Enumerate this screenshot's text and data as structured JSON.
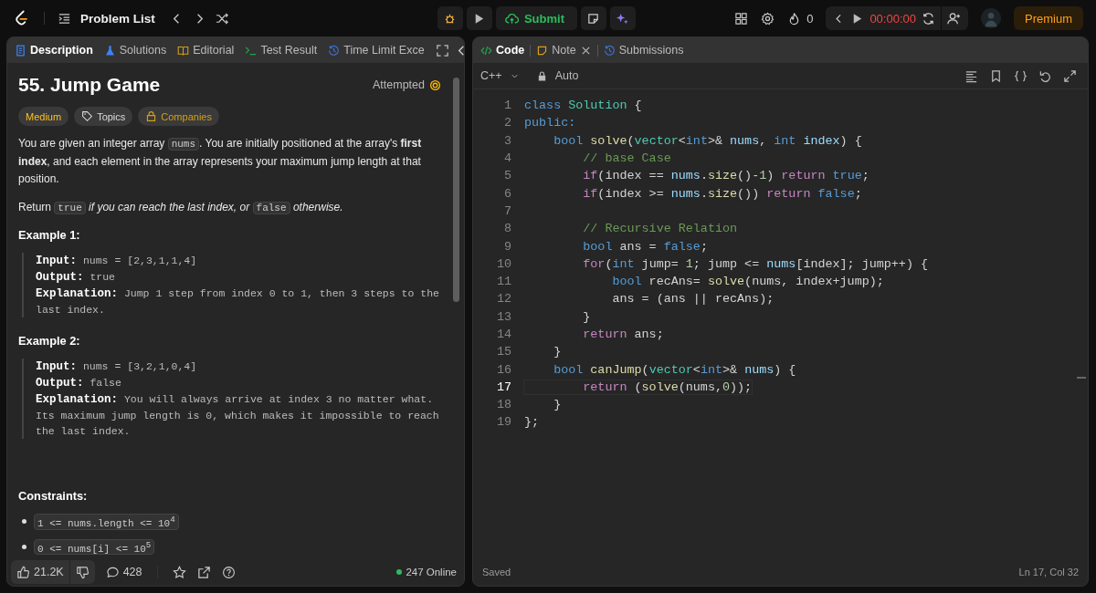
{
  "topbar": {
    "problem_list": "Problem List",
    "submit": "Submit",
    "streak": "0",
    "timer": "00:00:00",
    "premium": "Premium"
  },
  "left_panel": {
    "tabs": [
      {
        "label": "Description",
        "selected": true
      },
      {
        "label": "Solutions",
        "selected": false
      },
      {
        "label": "Editorial",
        "selected": false
      },
      {
        "label": "Test Result",
        "selected": false
      },
      {
        "label": "Time Limit Exce",
        "selected": false
      }
    ],
    "title": "55. Jump Game",
    "status": "Attempted",
    "tags": [
      {
        "label": "Medium",
        "kind": "difficulty"
      },
      {
        "label": "Topics",
        "kind": "topics"
      },
      {
        "label": "Companies",
        "kind": "companies"
      }
    ],
    "paragraphs": [
      [
        {
          "text": "You are given an integer array ",
          "kind": "text"
        },
        {
          "text": "nums",
          "kind": "code"
        },
        {
          "text": ". You are initially positioned at the array's **first index**, and each element in the array represents your maximum jump length at that position.",
          "kind": "text"
        }
      ],
      [
        {
          "text": "Return ",
          "kind": "text"
        },
        {
          "text": "true",
          "kind": "code"
        },
        {
          "text": " if you can reach the last index, or ",
          "kind": "italic"
        },
        {
          "text": "false",
          "kind": "code"
        },
        {
          "text": " otherwise.",
          "kind": "italic"
        }
      ]
    ],
    "examples": [
      {
        "heading": "Example 1:",
        "lines": [
          {
            "label": "Input:",
            "value": "nums = [2,3,1,1,4]"
          },
          {
            "label": "Output:",
            "value": "true"
          },
          {
            "label": "Explanation:",
            "value": "Jump 1 step from index 0 to 1, then 3 steps to the last index."
          }
        ]
      },
      {
        "heading": "Example 2:",
        "lines": [
          {
            "label": "Input:",
            "value": "nums = [3,2,1,0,4]"
          },
          {
            "label": "Output:",
            "value": "false"
          },
          {
            "label": "Explanation:",
            "value": "You will always arrive at index 3 no matter what. Its maximum jump length is 0, which makes it impossible to reach the last index."
          }
        ]
      }
    ],
    "constraints_heading": "Constraints:",
    "constraints": [
      "1 <= nums.length <= 10$^{4}$",
      "0 <= nums[i] <= 10$^{5}$"
    ],
    "footer": {
      "likes": "21.2K",
      "comments": "428",
      "online": "247 Online"
    }
  },
  "right_panel": {
    "tabs": [
      {
        "label": "Code",
        "selected": true,
        "closable": false
      },
      {
        "label": "Note",
        "selected": false,
        "closable": true
      },
      {
        "label": "Submissions",
        "selected": false,
        "closable": false
      }
    ],
    "language": "C++",
    "mode": "Auto",
    "code": [
      {
        "n": "1",
        "current": false,
        "tokens": [
          {
            "text": "class",
            "kind": "keyword"
          },
          {
            "text": " Solution",
            "kind": "type"
          },
          {
            "text": " {",
            "kind": "plain"
          }
        ]
      },
      {
        "n": "2",
        "current": false,
        "tokens": [
          {
            "text": "public:",
            "kind": "keyword"
          }
        ]
      },
      {
        "n": "3",
        "current": false,
        "tokens": [
          {
            "text": "    bool",
            "kind": "keyword"
          },
          {
            "text": " solve",
            "kind": "function"
          },
          {
            "text": "(",
            "kind": "plain"
          },
          {
            "text": "vector",
            "kind": "type"
          },
          {
            "text": "<",
            "kind": "plain"
          },
          {
            "text": "int",
            "kind": "keyword"
          },
          {
            "text": ">& ",
            "kind": "plain"
          },
          {
            "text": "nums",
            "kind": "variable"
          },
          {
            "text": ", ",
            "kind": "plain"
          },
          {
            "text": "int",
            "kind": "keyword"
          },
          {
            "text": " index",
            "kind": "variable"
          },
          {
            "text": ") {",
            "kind": "plain"
          }
        ]
      },
      {
        "n": "4",
        "current": false,
        "tokens": [
          {
            "text": "        // base Case",
            "kind": "comment"
          }
        ]
      },
      {
        "n": "5",
        "current": false,
        "tokens": [
          {
            "text": "        if",
            "kind": "control"
          },
          {
            "text": "(index == ",
            "kind": "plain"
          },
          {
            "text": "nums",
            "kind": "variable"
          },
          {
            "text": ".",
            "kind": "plain"
          },
          {
            "text": "size",
            "kind": "function"
          },
          {
            "text": "()-",
            "kind": "plain"
          },
          {
            "text": "1",
            "kind": "number"
          },
          {
            "text": ") ",
            "kind": "plain"
          },
          {
            "text": "return",
            "kind": "control"
          },
          {
            "text": " true",
            "kind": "keyword"
          },
          {
            "text": ";",
            "kind": "plain"
          }
        ]
      },
      {
        "n": "6",
        "current": false,
        "tokens": [
          {
            "text": "        if",
            "kind": "control"
          },
          {
            "text": "(index >= ",
            "kind": "plain"
          },
          {
            "text": "nums",
            "kind": "variable"
          },
          {
            "text": ".",
            "kind": "plain"
          },
          {
            "text": "size",
            "kind": "function"
          },
          {
            "text": "()) ",
            "kind": "plain"
          },
          {
            "text": "return",
            "kind": "control"
          },
          {
            "text": " false",
            "kind": "keyword"
          },
          {
            "text": ";",
            "kind": "plain"
          }
        ]
      },
      {
        "n": "7",
        "current": false
      },
      {
        "n": "8",
        "current": false,
        "tokens": [
          {
            "text": "        // Recursive Relation",
            "kind": "comment"
          }
        ]
      },
      {
        "n": "9",
        "current": false,
        "tokens": [
          {
            "text": "        bool",
            "kind": "keyword"
          },
          {
            "text": " ans = ",
            "kind": "plain"
          },
          {
            "text": "false",
            "kind": "keyword"
          },
          {
            "text": ";",
            "kind": "plain"
          }
        ]
      },
      {
        "n": "10",
        "current": false,
        "tokens": [
          {
            "text": "        for",
            "kind": "control"
          },
          {
            "text": "(",
            "kind": "plain"
          },
          {
            "text": "int",
            "kind": "keyword"
          },
          {
            "text": " jump= ",
            "kind": "plain"
          },
          {
            "text": "1",
            "kind": "number"
          },
          {
            "text": "; jump <= ",
            "kind": "plain"
          },
          {
            "text": "nums",
            "kind": "variable"
          },
          {
            "text": "[index]; jump++) {",
            "kind": "plain"
          }
        ]
      },
      {
        "n": "11",
        "current": false,
        "tokens": [
          {
            "text": "            bool",
            "kind": "keyword"
          },
          {
            "text": " recAns= ",
            "kind": "plain"
          },
          {
            "text": "solve",
            "kind": "function"
          },
          {
            "text": "(nums, index+jump);",
            "kind": "plain"
          }
        ]
      },
      {
        "n": "12",
        "current": false,
        "tokens": [
          {
            "text": "            ans = (ans || recAns);",
            "kind": "plain"
          }
        ]
      },
      {
        "n": "13",
        "current": false,
        "tokens": [
          {
            "text": "        }",
            "kind": "plain"
          }
        ]
      },
      {
        "n": "14",
        "current": false,
        "tokens": [
          {
            "text": "        return",
            "kind": "control"
          },
          {
            "text": " ans;",
            "kind": "plain"
          }
        ]
      },
      {
        "n": "15",
        "current": false,
        "tokens": [
          {
            "text": "    }",
            "kind": "plain"
          }
        ]
      },
      {
        "n": "16",
        "current": false,
        "tokens": [
          {
            "text": "    bool",
            "kind": "keyword"
          },
          {
            "text": " canJump",
            "kind": "function"
          },
          {
            "text": "(",
            "kind": "plain"
          },
          {
            "text": "vector",
            "kind": "type"
          },
          {
            "text": "<",
            "kind": "plain"
          },
          {
            "text": "int",
            "kind": "keyword"
          },
          {
            "text": ">& ",
            "kind": "plain"
          },
          {
            "text": "nums",
            "kind": "variable"
          },
          {
            "text": ") {",
            "kind": "plain"
          }
        ]
      },
      {
        "n": "17",
        "current": true,
        "tokens": [
          {
            "text": "        return",
            "kind": "control"
          },
          {
            "text": " (",
            "kind": "plain"
          },
          {
            "text": "solve",
            "kind": "function"
          },
          {
            "text": "(nums,",
            "kind": "plain"
          },
          {
            "text": "0",
            "kind": "number"
          },
          {
            "text": "));",
            "kind": "plain"
          }
        ]
      },
      {
        "n": "18",
        "current": false,
        "tokens": [
          {
            "text": "    }",
            "kind": "plain"
          }
        ]
      },
      {
        "n": "19",
        "current": false,
        "tokens": [
          {
            "text": "};",
            "kind": "plain"
          }
        ]
      }
    ],
    "status": "Saved",
    "cursor": "Ln 17, Col 32"
  }
}
